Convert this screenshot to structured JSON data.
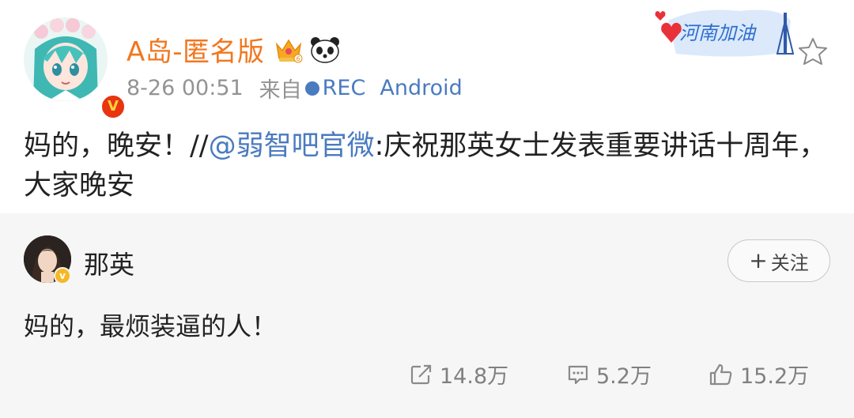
{
  "post": {
    "author": "A岛-匿名版",
    "time": "8-26 00:51",
    "source_label": "来自",
    "source_rec": "REC",
    "source_device": "Android",
    "badge_text": "河南加油",
    "text_before": "妈的，晚安！//",
    "mention": "@弱智吧官微",
    "text_after": ":庆祝那英女士发表重要讲话十周年，大家晚安"
  },
  "repost": {
    "author": "那英",
    "follow_label": "关注",
    "text": "妈的，最烦装逼的人！",
    "shares": "14.8万",
    "comments": "5.2万",
    "likes": "15.2万"
  },
  "colors": {
    "author_orange": "#f1771e",
    "link_blue": "#4a7bbf",
    "meta_gray": "#939393",
    "repost_bg": "#f6f6f6"
  },
  "icons": [
    "crown-icon",
    "panda-icon",
    "star-icon",
    "verified-icon",
    "share-icon",
    "comment-icon",
    "like-icon"
  ]
}
